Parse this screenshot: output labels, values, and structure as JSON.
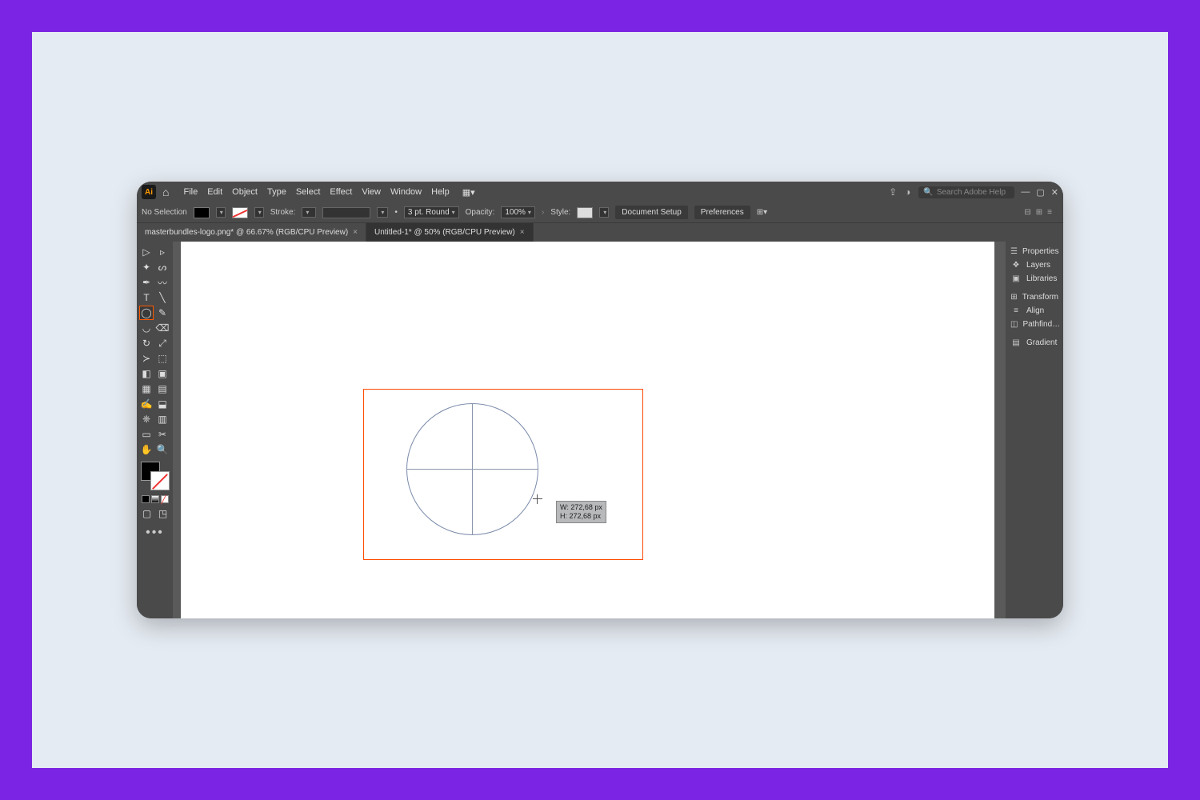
{
  "menu": {
    "items": [
      "File",
      "Edit",
      "Object",
      "Type",
      "Select",
      "Effect",
      "View",
      "Window",
      "Help"
    ]
  },
  "search": {
    "placeholder": "Search Adobe Help"
  },
  "control": {
    "no_selection": "No Selection",
    "stroke_label": "Stroke:",
    "stroke_weight": "3 pt. Round",
    "opacity_label": "Opacity:",
    "opacity_value": "100%",
    "style_label": "Style:",
    "doc_setup": "Document Setup",
    "prefs": "Preferences"
  },
  "tabs": [
    {
      "label": "masterbundles-logo.png* @ 66.67% (RGB/CPU Preview)",
      "active": false
    },
    {
      "label": "Untitled-1* @ 50% (RGB/CPU Preview)",
      "active": true
    }
  ],
  "measure": {
    "w_label": "W:",
    "w_val": "272,68 px",
    "h_label": "H:",
    "h_val": "272,68 px"
  },
  "right_panels": {
    "properties": "Properties",
    "layers": "Layers",
    "libraries": "Libraries",
    "transform": "Transform",
    "align": "Align",
    "pathfinder": "Pathfind…",
    "gradient": "Gradient"
  }
}
